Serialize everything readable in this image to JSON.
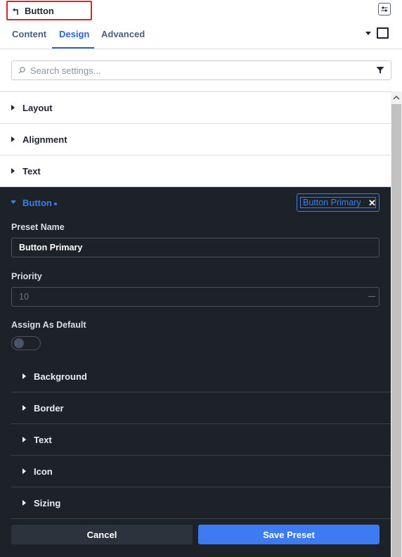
{
  "header": {
    "title": "Button"
  },
  "tabs": [
    {
      "label": "Content"
    },
    {
      "label": "Design"
    },
    {
      "label": "Advanced"
    }
  ],
  "active_tab": "Design",
  "search": {
    "placeholder": "Search settings...",
    "value": ""
  },
  "sections": [
    {
      "label": "Layout"
    },
    {
      "label": "Alignment"
    },
    {
      "label": "Text"
    }
  ],
  "button_section": {
    "label": "Button",
    "preset_chip": "Button Primary",
    "preset_name_label": "Preset Name",
    "preset_name_value": "Button Primary",
    "priority_label": "Priority",
    "priority_placeholder": "10",
    "assign_default_label": "Assign As Default",
    "assign_default_on": false,
    "subsections": [
      {
        "label": "Background"
      },
      {
        "label": "Border"
      },
      {
        "label": "Text"
      },
      {
        "label": "Icon"
      },
      {
        "label": "Sizing"
      }
    ],
    "cancel_label": "Cancel",
    "save_label": "Save Preset"
  },
  "colors": {
    "accent": "#3c7bf2",
    "dark_panel": "#1d2229",
    "highlight_border": "#d6262b"
  },
  "icons": {
    "back": "back-arrow-icon",
    "filter": "sliders-icon",
    "dropdown": "caret-down-icon",
    "responsive": "square-icon",
    "search": "search-icon",
    "funnel": "funnel-icon"
  }
}
